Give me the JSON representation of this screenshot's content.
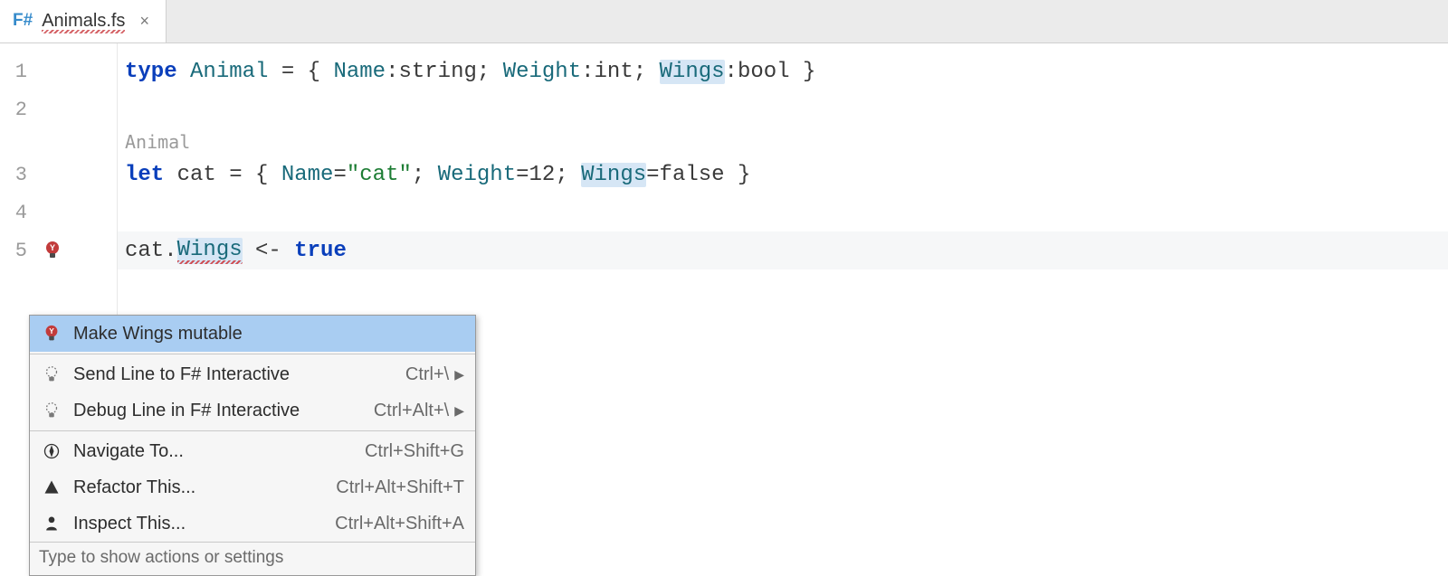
{
  "tab": {
    "badge": "F#",
    "filename": "Animals.fs"
  },
  "gutter": {
    "lines": [
      "1",
      "2",
      "3",
      "4",
      "5"
    ]
  },
  "code": {
    "line1": {
      "kw_type": "type",
      "name": "Animal",
      "eq": " = { ",
      "f1": "Name",
      "t1": ":string; ",
      "f2": "Weight",
      "t2": ":int; ",
      "f3": "Wings",
      "t3": ":bool }"
    },
    "hint_annot": "Animal",
    "line3": {
      "kw_let": "let",
      "name": " cat = { ",
      "f1": "Name",
      "v1": "=",
      "s1": "\"cat\"",
      "sep1": "; ",
      "f2": "Weight",
      "v2": "=12; ",
      "f3": "Wings",
      "v3": "=false }"
    },
    "line5": {
      "obj": "cat.",
      "prop": "Wings",
      "assign": " <- ",
      "val": "true"
    }
  },
  "popup": {
    "items": [
      {
        "label": "Make Wings mutable",
        "shortcut": "",
        "arrow": false
      },
      {
        "label": "Send Line to F# Interactive",
        "shortcut": "Ctrl+\\",
        "arrow": true
      },
      {
        "label": "Debug Line in F# Interactive",
        "shortcut": "Ctrl+Alt+\\",
        "arrow": true
      },
      {
        "label": "Navigate To...",
        "shortcut": "Ctrl+Shift+G",
        "arrow": false
      },
      {
        "label": "Refactor This...",
        "shortcut": "Ctrl+Alt+Shift+T",
        "arrow": false
      },
      {
        "label": "Inspect This...",
        "shortcut": "Ctrl+Alt+Shift+A",
        "arrow": false
      }
    ],
    "footer": "Type to show actions or settings"
  }
}
